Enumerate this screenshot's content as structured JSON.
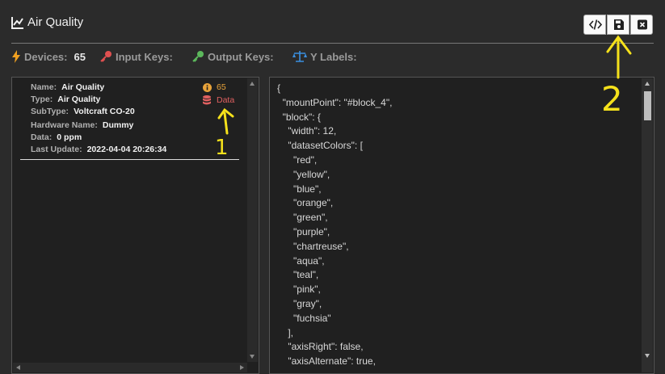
{
  "header": {
    "title": "Air Quality",
    "icons": [
      "chart-line-icon",
      "code-icon",
      "floppy-disk-icon",
      "close-icon"
    ]
  },
  "stats": {
    "devices_label": "Devices:",
    "devices_value": "65",
    "input_keys_label": "Input Keys:",
    "output_keys_label": "Output Keys:",
    "y_labels_label": "Y Labels:",
    "colors": {
      "bolt": "#f0a020",
      "input_key": "#e05050",
      "output_key": "#5cb85c",
      "scale": "#3a8fe0"
    }
  },
  "device": {
    "fields": [
      {
        "label": "Name:",
        "value": "Air Quality"
      },
      {
        "label": "Type:",
        "value": "Air Quality"
      },
      {
        "label": "SubType:",
        "value": "Voltcraft CO-20"
      },
      {
        "label": "Hardware Name:",
        "value": "Dummy"
      },
      {
        "label": "Data:",
        "value": "0 ppm"
      },
      {
        "label": "Last Update:",
        "value": "2022-04-04 20:26:34"
      }
    ],
    "id_badge": "65",
    "data_badge": "Data",
    "badge_colors": {
      "id": "#e8a33a",
      "data": "#e06060"
    }
  },
  "code": {
    "lines": [
      "{",
      "  \"mountPoint\": \"#block_4\",",
      "  \"block\": {",
      "    \"width\": 12,",
      "    \"datasetColors\": [",
      "      \"red\",",
      "      \"yellow\",",
      "      \"blue\",",
      "      \"orange\",",
      "      \"green\",",
      "      \"purple\",",
      "      \"chartreuse\",",
      "      \"aqua\",",
      "      \"teal\",",
      "      \"pink\",",
      "      \"gray\",",
      "      \"fuchsia\"",
      "    ],",
      "    \"axisRight\": false,",
      "    \"axisAlternate\": true,"
    ]
  },
  "annotations": {
    "marker_1": "1",
    "marker_2": "2",
    "color": "#f5e11b"
  }
}
